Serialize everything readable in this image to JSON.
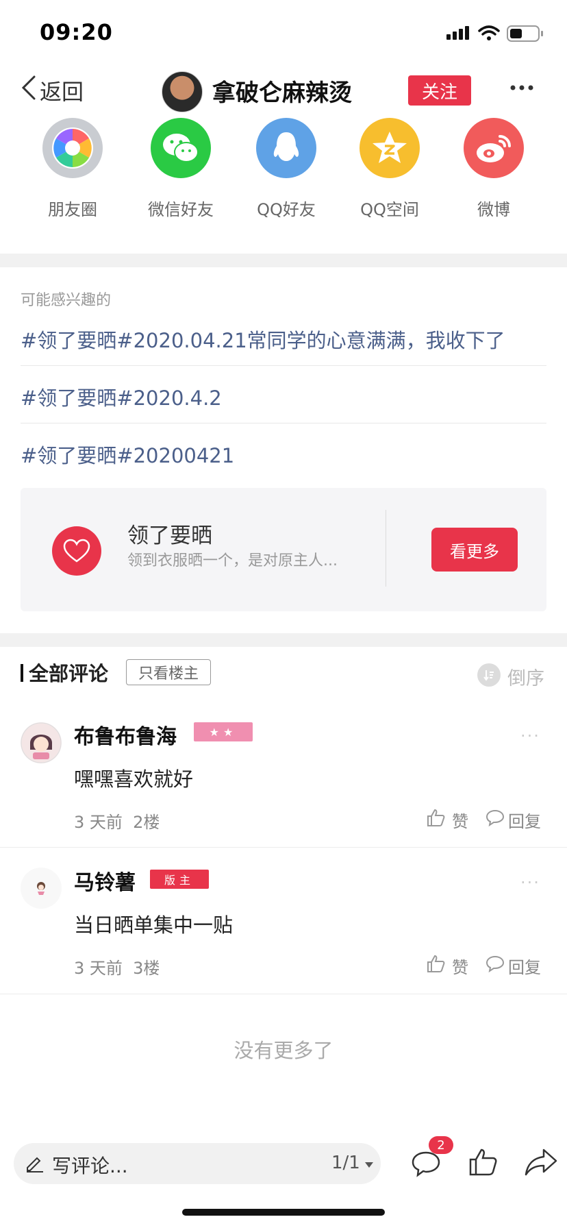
{
  "status_bar": {
    "time": "09:20"
  },
  "nav": {
    "back_label": "返回",
    "title": "拿破仑麻辣烫",
    "follow_label": "关注"
  },
  "share": [
    {
      "label": "朋友圈",
      "icon": "moments-icon",
      "color": "#c9ccd1"
    },
    {
      "label": "微信好友",
      "icon": "wechat-icon",
      "color": "#2aca44"
    },
    {
      "label": "QQ好友",
      "icon": "qq-icon",
      "color": "#5fa2e6"
    },
    {
      "label": "QQ空间",
      "icon": "qzone-icon",
      "color": "#f7be2e"
    },
    {
      "label": "微博",
      "icon": "weibo-icon",
      "color": "#f15b5b"
    }
  ],
  "interested": {
    "title": "可能感兴趣的",
    "topics": [
      "#领了要晒#2020.04.21常同学的心意满满，我收下了",
      "#领了要晒#2020.4.2",
      "#领了要晒#20200421"
    ],
    "card": {
      "title": "领了要晒",
      "subtitle": "领到衣服晒一个，是对原主人...",
      "button": "看更多"
    }
  },
  "comments_section": {
    "title": "全部评论",
    "only_owner_label": "只看楼主",
    "sort_label": "倒序",
    "comments": [
      {
        "name": "布鲁布鲁海",
        "badge": "★★",
        "text": "嘿嘿喜欢就好",
        "meta": "3 天前  2楼",
        "like": "赞",
        "reply": "回复"
      },
      {
        "name": "马铃薯",
        "badge": "版主",
        "text": "当日晒单集中一贴",
        "meta": "3 天前  3楼",
        "like": "赞",
        "reply": "回复"
      }
    ],
    "no_more": "没有更多了"
  },
  "bottom_bar": {
    "placeholder": "写评论...",
    "page": "1/1",
    "comment_count": "2"
  },
  "colors": {
    "accent": "#e8344a",
    "link": "#4b5f8a"
  }
}
